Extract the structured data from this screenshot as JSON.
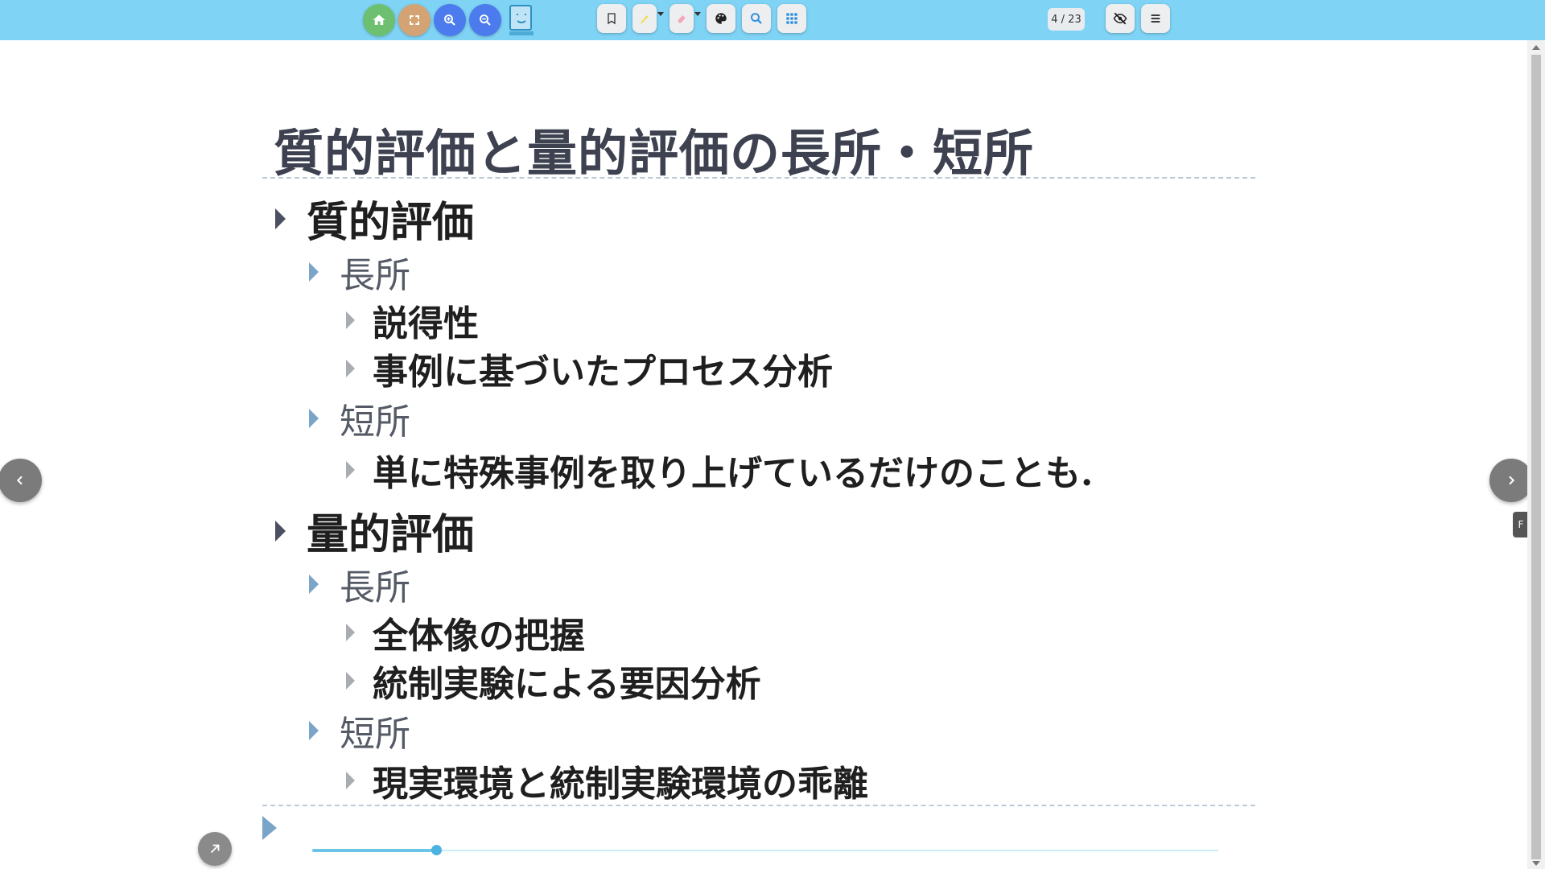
{
  "toolbar": {
    "page_counter": "4 / 23",
    "buttons": {
      "home": {
        "icon": "home-icon",
        "color": "#6cc070"
      },
      "fullscreen": {
        "icon": "fullscreen-icon",
        "color": "#d4a373"
      },
      "zoom_in": {
        "icon": "zoom-in-icon",
        "color": "#4b7bec"
      },
      "zoom_out": {
        "icon": "zoom-out-icon",
        "color": "#4b7bec"
      }
    },
    "logo_icon": "book-logo-icon",
    "tools": [
      "bookmark-icon",
      "highlighter-icon",
      "eraser-icon",
      "palette-icon",
      "search-icon",
      "grid-icon"
    ],
    "right_tools": [
      "eye-off-icon",
      "menu-icon"
    ]
  },
  "slide": {
    "title": "質的評価と量的評価の長所・短所",
    "items": [
      {
        "level": 1,
        "text": "質的評価"
      },
      {
        "level": 2,
        "text": "長所"
      },
      {
        "level": 3,
        "text": "説得性"
      },
      {
        "level": 3,
        "text": "事例に基づいたプロセス分析"
      },
      {
        "level": 2,
        "text": "短所"
      },
      {
        "level": 3,
        "text": "単に特殊事例を取り上げているだけのことも."
      },
      {
        "level": 1,
        "text": "量的評価"
      },
      {
        "level": 2,
        "text": "長所"
      },
      {
        "level": 3,
        "text": "全体像の把握"
      },
      {
        "level": 3,
        "text": "統制実験による要因分析"
      },
      {
        "level": 2,
        "text": "短所"
      },
      {
        "level": 3,
        "text": "現実環境と統制実験環境の乖離"
      }
    ]
  },
  "progress": {
    "value": 0.137
  },
  "side_tab": {
    "label": "F"
  },
  "colors": {
    "toolbar_bg": "#7fd3f5",
    "accent": "#4cb3e0"
  }
}
